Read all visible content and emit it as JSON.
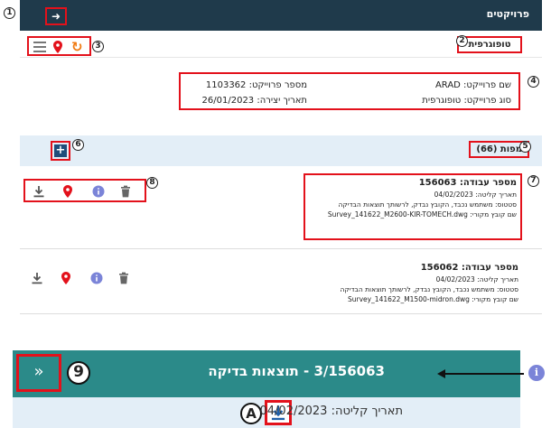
{
  "header": {
    "title": "פרויקטים",
    "back_icon": "arrow-right-icon",
    "back_glyph": "➜"
  },
  "toolbar": {
    "tab_label": "טופוגרפית",
    "icons": [
      "hamburger-menu-icon",
      "map-pin-icon",
      "refresh-icon"
    ],
    "refresh_glyph": "↻"
  },
  "project": {
    "name": "שם פרוייקט: ARAD",
    "number": "מספר פרוייקט: 1103362",
    "type": "סוג פרוייקט: טופוגרפית",
    "created": "תאריך יצירה: 26/01/2023"
  },
  "maps": {
    "title": "מפות (66)",
    "add_glyph": "+"
  },
  "jobs": [
    {
      "number": "מספר עבודה: 156063",
      "capture_date": "תאריך קליטה: 04/02/2023",
      "status": "סטטוס: משתמש נכבד, הקובץ נבדק, לרשותך תוצאות הבדיקה",
      "source_file": "שם קובץ מקורי: Survey_141622_M2600-KIR-TOMECH.dwg"
    },
    {
      "number": "מספר עבודה: 156062",
      "capture_date": "תאריך קליטה: 04/02/2023",
      "status": "סטטוס: משתמש נכבד, הקובץ נבדק, לרשותך תוצאות הבדיקה",
      "source_file": "שם קובץ מקורי: Survey_141622_M1500-midron.dwg"
    }
  ],
  "job_actions": [
    "download-icon",
    "map-pin-icon",
    "info-icon",
    "trash-icon"
  ],
  "callouts": [
    "1",
    "2",
    "3",
    "4",
    "5",
    "6",
    "7",
    "8",
    "9",
    "A"
  ],
  "detail_view": {
    "title": "3/156063 - תוצאות בדיקה",
    "expand_glyph": "»",
    "capture_date": "תאריך קליטה: 04/02/2023",
    "info_glyph": "i"
  },
  "colors": {
    "header_bg": "#1f3a4b",
    "highlight": "#e3111b",
    "pin": "#e3111b",
    "refresh": "#f07a12",
    "info": "#7b84d8",
    "teal": "#2b8a89",
    "light_bar": "#e3eef7"
  }
}
